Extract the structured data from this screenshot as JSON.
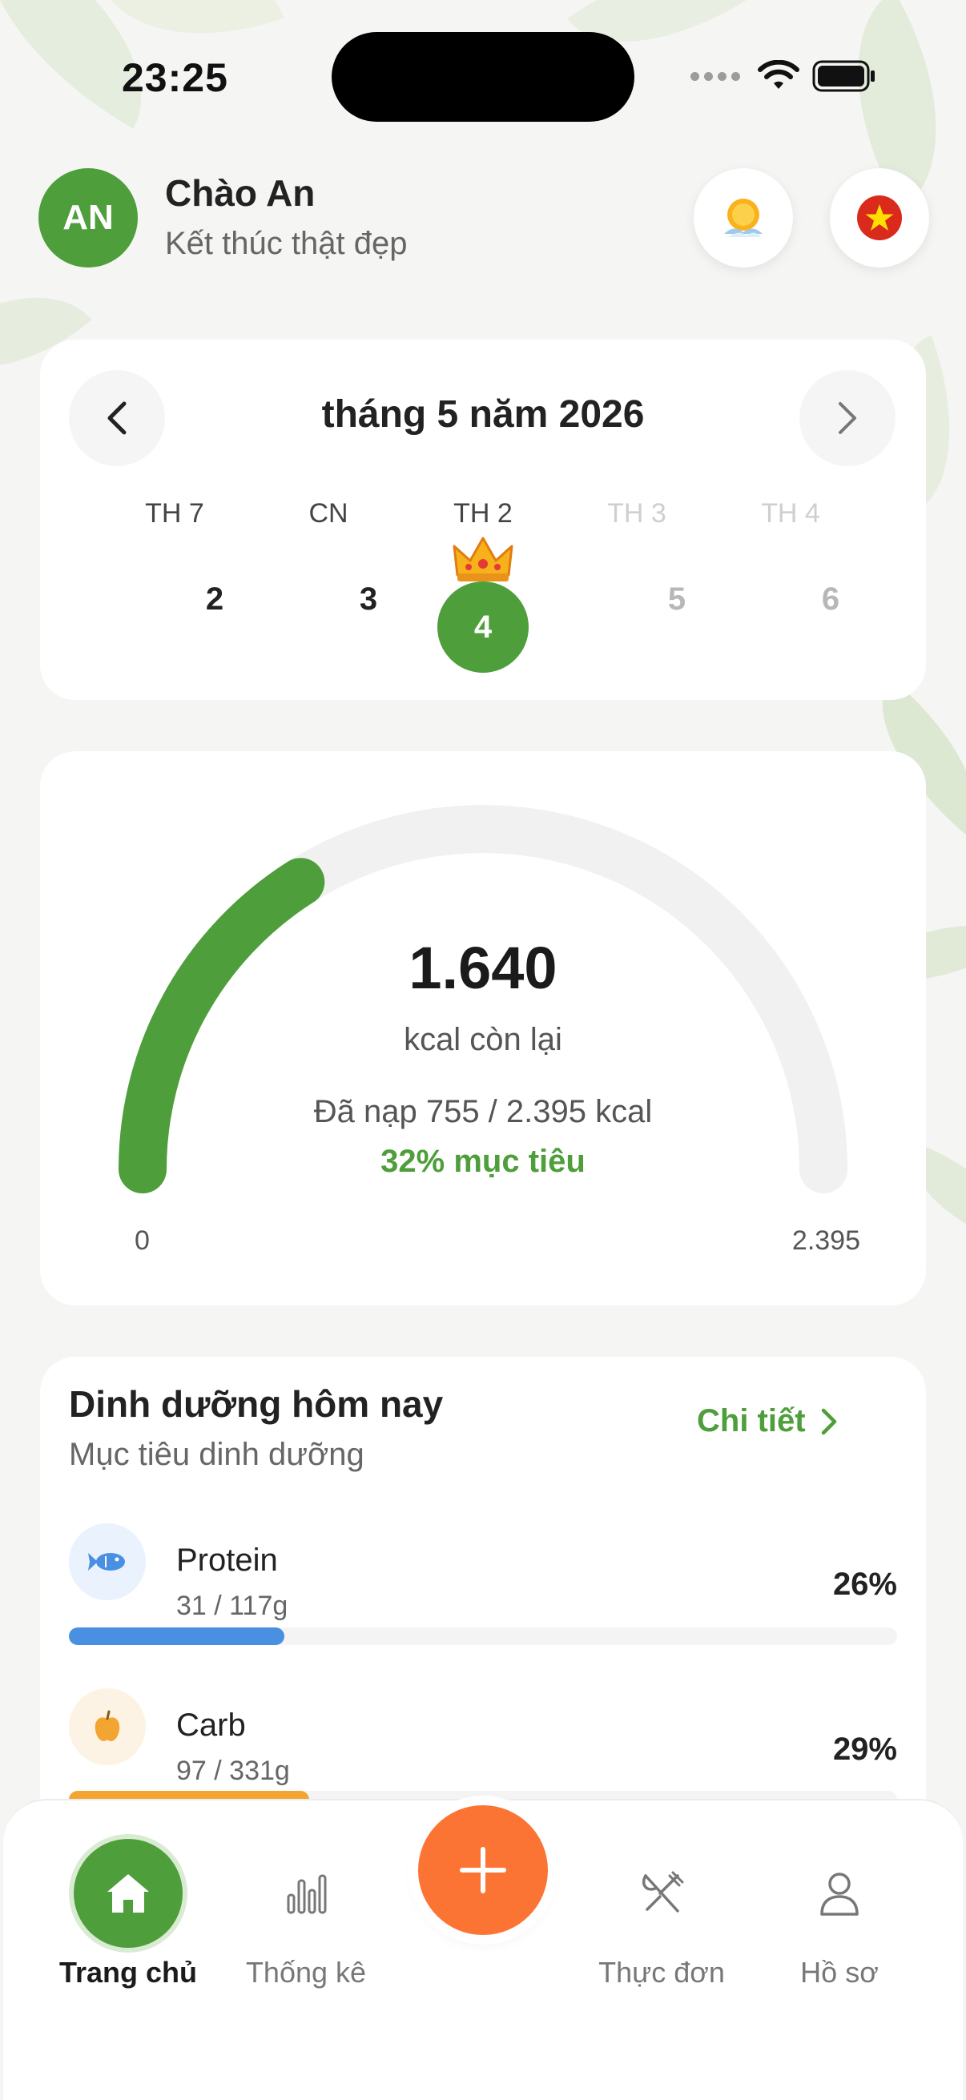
{
  "status_bar": {
    "time": "23:25"
  },
  "header": {
    "avatar_initials": "AN",
    "greeting": "Chào An",
    "subtitle": "Kết thúc thật đẹp",
    "weather_icon": "sun-icon",
    "language_icon": "vietnam-flag-icon"
  },
  "calendar": {
    "month_label": "tháng 5 năm 2026",
    "days": [
      {
        "dow": "TH 7",
        "date": "2"
      },
      {
        "dow": "CN",
        "date": "3"
      },
      {
        "dow": "TH 2",
        "date": "4",
        "selected": true
      },
      {
        "dow": "TH 3",
        "date": "5"
      },
      {
        "dow": "TH 4",
        "date": "6"
      }
    ]
  },
  "calories": {
    "remaining": "1.640",
    "remaining_label": "kcal còn lại",
    "consumed_text": "Đã nạp 755 / 2.395 kcal",
    "goal_percent_text": "32% mục tiêu",
    "progress_fraction": 0.32,
    "min_label": "0",
    "max_label": "2.395"
  },
  "nutrition": {
    "title": "Dinh dưỡng hôm nay",
    "subtitle": "Mục tiêu dinh dưỡng",
    "detail_label": "Chi tiết",
    "items": [
      {
        "name": "Protein",
        "amount": "31 / 117g",
        "percent": "26%",
        "fraction": 0.26,
        "color": "#4a90e2",
        "icon": "fish-icon"
      },
      {
        "name": "Carb",
        "amount": "97 / 331g",
        "percent": "29%",
        "fraction": 0.29,
        "color": "#f2a531",
        "icon": "apple-icon"
      }
    ]
  },
  "bottom_nav": {
    "items": [
      {
        "label": "Trang chủ",
        "icon": "home-icon",
        "active": true
      },
      {
        "label": "Thống kê",
        "icon": "bar-chart-icon"
      },
      {
        "label": "Thực đơn",
        "icon": "utensils-icon"
      },
      {
        "label": "Hồ sơ",
        "icon": "user-icon"
      }
    ],
    "fab_icon": "plus-icon"
  },
  "colors": {
    "primary_green": "#4e9e3b",
    "fab_orange": "#fb7434",
    "protein_blue": "#4a90e2",
    "carb_orange": "#f2a531"
  }
}
